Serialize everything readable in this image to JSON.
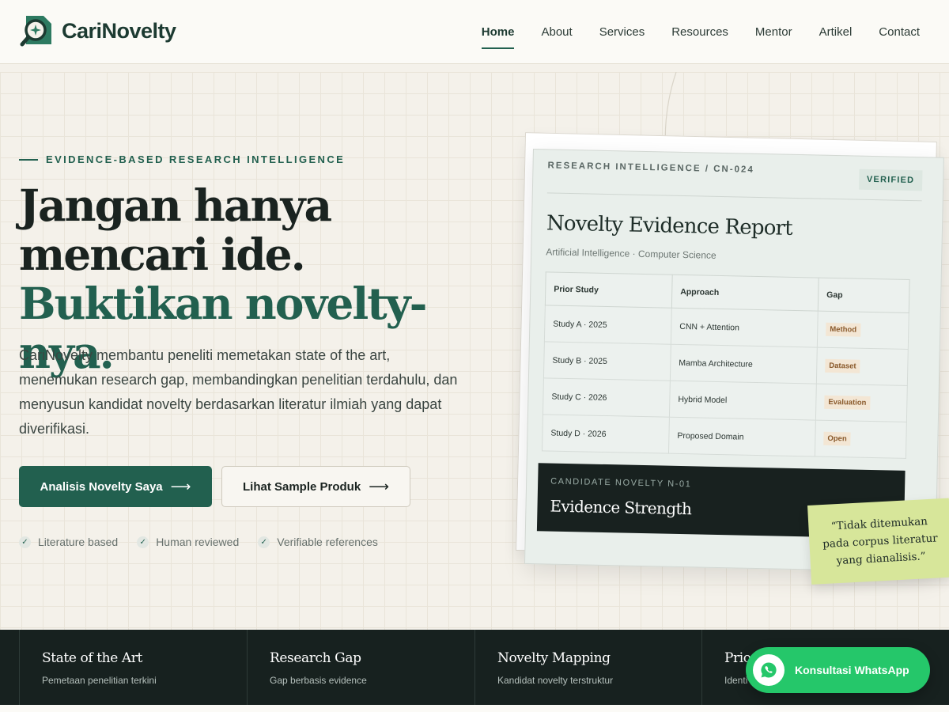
{
  "brand": {
    "name": "CariNovelty"
  },
  "nav": {
    "items": [
      {
        "label": "Home",
        "active": true
      },
      {
        "label": "About"
      },
      {
        "label": "Services"
      },
      {
        "label": "Resources"
      },
      {
        "label": "Mentor"
      },
      {
        "label": "Artikel"
      },
      {
        "label": "Contact"
      }
    ]
  },
  "hero": {
    "eyebrow": "EVIDENCE-BASED RESEARCH INTELLIGENCE",
    "headline_line1": "Jangan hanya mencari ide.",
    "headline_line2": "Buktikan novelty-nya.",
    "lead": "CariNovelty membantu peneliti memetakan state of the art, menemukan research gap, membandingkan penelitian terdahulu, dan menyusun kandidat novelty berdasarkan literatur ilmiah yang dapat diverifikasi.",
    "primary_cta": "Analisis Novelty Saya",
    "secondary_cta": "Lihat Sample Produk",
    "arrow": "⟶",
    "checks": [
      "Literature based",
      "Human reviewed",
      "Verifiable references"
    ]
  },
  "report": {
    "eyebrow": "RESEARCH INTELLIGENCE / CN-024",
    "badge": "VERIFIED",
    "title": "Novelty Evidence Report",
    "subtitle": "Artificial Intelligence · Computer Science",
    "columns": [
      "Prior Study",
      "Approach",
      "Gap"
    ],
    "rows": [
      {
        "study": "Study A · 2025",
        "approach": "CNN + Attention",
        "gap": "Method"
      },
      {
        "study": "Study B · 2025",
        "approach": "Mamba Architecture",
        "gap": "Dataset"
      },
      {
        "study": "Study C · 2026",
        "approach": "Hybrid Model",
        "gap": "Evaluation"
      },
      {
        "study": "Study D · 2026",
        "approach": "Proposed Domain",
        "gap": "Open"
      }
    ],
    "candidate_eyebrow": "CANDIDATE NOVELTY N-01",
    "candidate_title": "Evidence Strength",
    "note": "“Tidak ditemukan pada corpus literatur yang dianalisis.”"
  },
  "features": [
    {
      "title": "State of the Art",
      "desc": "Pemetaan penelitian terkini"
    },
    {
      "title": "Research Gap",
      "desc": "Gap berbasis evidence"
    },
    {
      "title": "Novelty Mapping",
      "desc": "Kandidat novelty terstruktur"
    },
    {
      "title": "Prio",
      "desc": "Identi"
    }
  ],
  "whatsapp": {
    "label": "Konsultasi WhatsApp"
  },
  "colors": {
    "primary": "#22604f",
    "dark": "#17211f",
    "whatsapp": "#25c76a",
    "sticky": "#d7e69a"
  }
}
